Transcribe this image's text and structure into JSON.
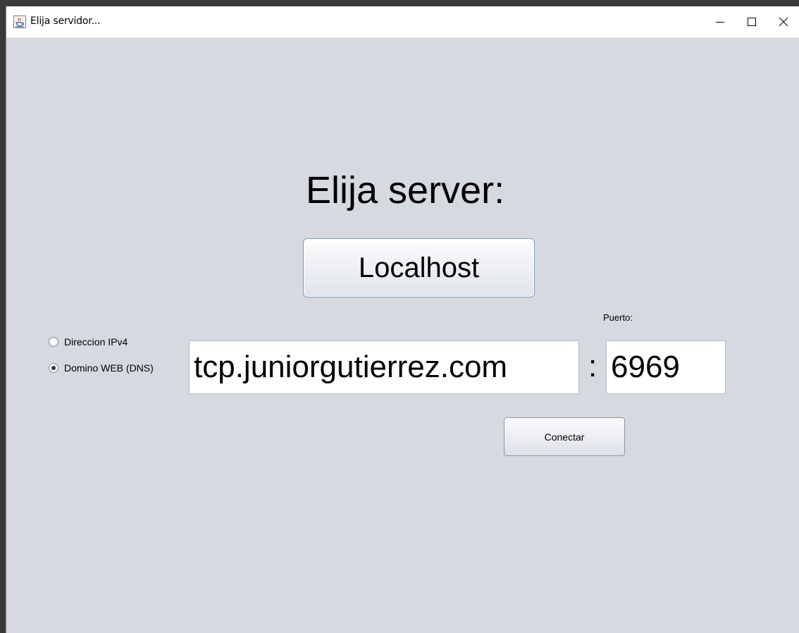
{
  "window": {
    "title": "Elija servidor..."
  },
  "content": {
    "heading": "Elija server:",
    "localhost_label": "Localhost",
    "puerto_label": "Puerto:",
    "radio_options": [
      {
        "label": "Direccion IPv4",
        "selected": false
      },
      {
        "label": "Domino WEB (DNS)",
        "selected": true
      }
    ],
    "host_value": "tcp.juniorgutierrez.com",
    "separator": ":",
    "port_value": "6969",
    "connect_label": "Conectar"
  },
  "colors": {
    "background": "#d6d9e0",
    "titlebar": "#ffffff",
    "button_border": "#7a9cc0"
  }
}
